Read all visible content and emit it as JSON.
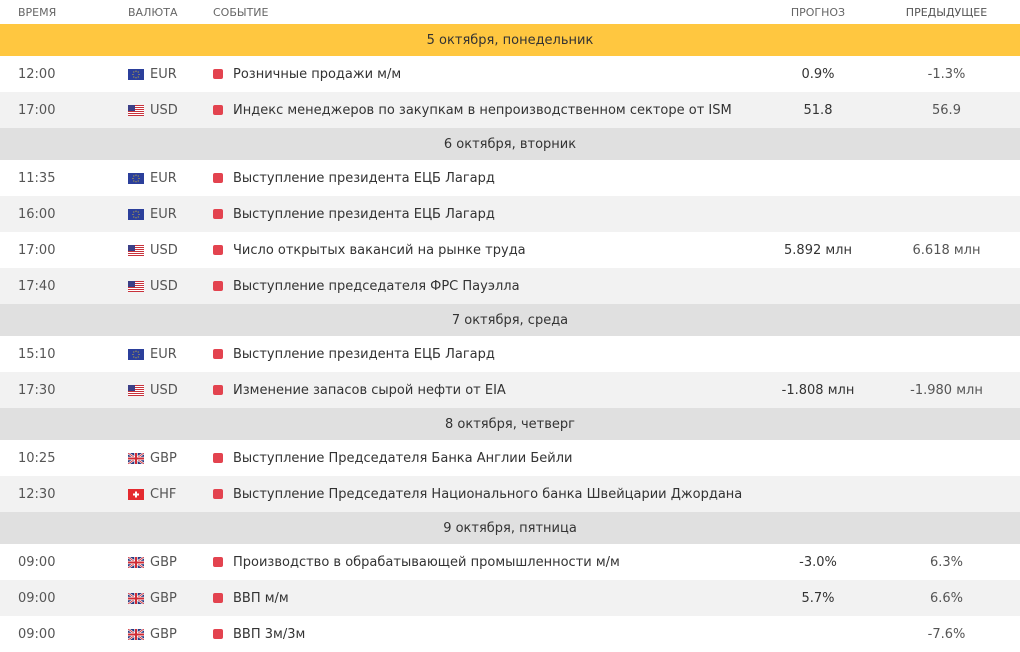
{
  "columns": {
    "time": "ВРЕМЯ",
    "currency": "ВАЛЮТА",
    "event": "СОБЫТИЕ",
    "forecast": "ПРОГНОЗ",
    "previous": "ПРЕДЫДУЩЕЕ"
  },
  "rows": [
    {
      "type": "day",
      "label": "5 октября, понедельник",
      "highlight": true
    },
    {
      "type": "event",
      "time": "12:00",
      "flag": "eu",
      "currency": "EUR",
      "event": "Розничные продажи м/м",
      "forecast": "0.9%",
      "previous": "-1.3%"
    },
    {
      "type": "event",
      "time": "17:00",
      "flag": "us",
      "currency": "USD",
      "event": "Индекс менеджеров по закупкам в непроизводственном секторе от ISM",
      "forecast": "51.8",
      "previous": "56.9"
    },
    {
      "type": "day",
      "label": "6 октября, вторник",
      "highlight": false
    },
    {
      "type": "event",
      "time": "11:35",
      "flag": "eu",
      "currency": "EUR",
      "event": "Выступление президента ЕЦБ Лагард",
      "forecast": "",
      "previous": ""
    },
    {
      "type": "event",
      "time": "16:00",
      "flag": "eu",
      "currency": "EUR",
      "event": "Выступление президента ЕЦБ Лагард",
      "forecast": "",
      "previous": ""
    },
    {
      "type": "event",
      "time": "17:00",
      "flag": "us",
      "currency": "USD",
      "event": "Число открытых вакансий на рынке труда",
      "forecast": "5.892 млн",
      "previous": "6.618 млн"
    },
    {
      "type": "event",
      "time": "17:40",
      "flag": "us",
      "currency": "USD",
      "event": "Выступление председателя ФРС Пауэлла",
      "forecast": "",
      "previous": ""
    },
    {
      "type": "day",
      "label": "7 октября, среда",
      "highlight": false
    },
    {
      "type": "event",
      "time": "15:10",
      "flag": "eu",
      "currency": "EUR",
      "event": "Выступление президента ЕЦБ Лагард",
      "forecast": "",
      "previous": ""
    },
    {
      "type": "event",
      "time": "17:30",
      "flag": "us",
      "currency": "USD",
      "event": "Изменение запасов сырой нефти от EIA",
      "forecast": "-1.808 млн",
      "previous": "-1.980 млн"
    },
    {
      "type": "day",
      "label": "8 октября, четверг",
      "highlight": false
    },
    {
      "type": "event",
      "time": "10:25",
      "flag": "gb",
      "currency": "GBP",
      "event": "Выступление Председателя Банка Англии Бейли",
      "forecast": "",
      "previous": ""
    },
    {
      "type": "event",
      "time": "12:30",
      "flag": "ch",
      "currency": "CHF",
      "event": "Выступление Председателя Национального банка Швейцарии Джордана",
      "forecast": "",
      "previous": ""
    },
    {
      "type": "day",
      "label": "9 октября, пятница",
      "highlight": false
    },
    {
      "type": "event",
      "time": "09:00",
      "flag": "gb",
      "currency": "GBP",
      "event": "Производство в обрабатывающей промышленности м/м",
      "forecast": "-3.0%",
      "previous": "6.3%"
    },
    {
      "type": "event",
      "time": "09:00",
      "flag": "gb",
      "currency": "GBP",
      "event": "ВВП м/м",
      "forecast": "5.7%",
      "previous": "6.6%"
    },
    {
      "type": "event",
      "time": "09:00",
      "flag": "gb",
      "currency": "GBP",
      "event": "ВВП 3м/3м",
      "forecast": "",
      "previous": "-7.6%"
    }
  ],
  "colors": {
    "highlight_day": "#ffc740",
    "day_bar": "#e0e0e0",
    "row_alt": "#f2f2f2",
    "importance": "#e3434f"
  }
}
